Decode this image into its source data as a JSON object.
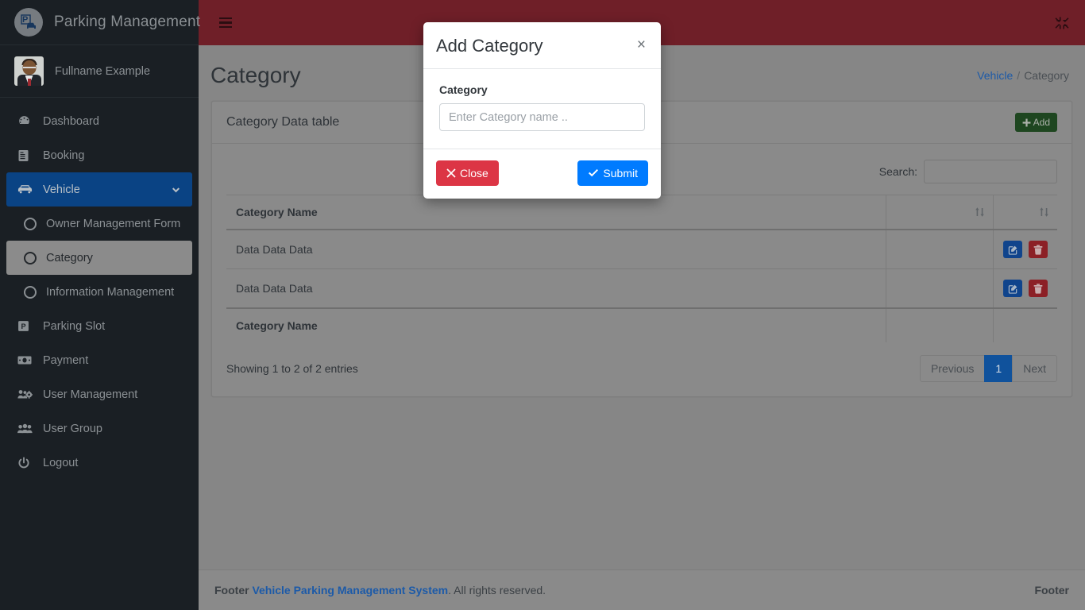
{
  "brand": {
    "title": "Parking Management",
    "logo_icon": "parking-car-logo-icon"
  },
  "user": {
    "name": "Fullname Example",
    "avatar_icon": "user-avatar"
  },
  "sidebar": {
    "items": [
      {
        "label": "Dashboard",
        "icon": "dashboard-icon",
        "type": "item"
      },
      {
        "label": "Booking",
        "icon": "book-icon",
        "type": "item"
      },
      {
        "label": "Vehicle",
        "icon": "car-icon",
        "type": "item",
        "active": true,
        "chevron": "chevron-down-icon"
      },
      {
        "label": "Owner Management Form",
        "icon": "circle-icon",
        "type": "sub"
      },
      {
        "label": "Category",
        "icon": "circle-icon",
        "type": "sub",
        "active": true
      },
      {
        "label": "Information Management",
        "icon": "circle-icon",
        "type": "sub"
      },
      {
        "label": "Parking Slot",
        "icon": "parking-square-icon",
        "type": "item"
      },
      {
        "label": "Payment",
        "icon": "money-bill-icon",
        "type": "item"
      },
      {
        "label": "User Management",
        "icon": "users-cog-icon",
        "type": "item"
      },
      {
        "label": "User Group",
        "icon": "users-icon",
        "type": "item"
      },
      {
        "label": "Logout",
        "icon": "power-off-icon",
        "type": "item"
      }
    ]
  },
  "navbar": {
    "menu_toggle_icon": "hamburger-icon",
    "fullscreen_icon": "compress-icon",
    "bg_color": "#6f1f28"
  },
  "page": {
    "title": "Category",
    "breadcrumb": {
      "parent": "Vehicle",
      "separator": "/",
      "current": "Category"
    }
  },
  "card": {
    "title": "Category Data table",
    "add_button": {
      "label": "Add",
      "icon": "plus-icon",
      "color": "#1e4620"
    }
  },
  "datatable": {
    "search_label": "Search:",
    "search_value": "",
    "search_placeholder": "",
    "columns": [
      "Category Name",
      "",
      ""
    ],
    "header": {
      "col1": "Category Name",
      "col2": "",
      "col3": ""
    },
    "footer_row": {
      "col1": "Category Name",
      "col2": "",
      "col3": ""
    },
    "sort_icon": "sort-arrows-icon",
    "rows": [
      {
        "name": "Data Data Data",
        "edit_icon": "edit-pencil-icon",
        "delete_icon": "trash-icon"
      },
      {
        "name": "Data Data Data",
        "edit_icon": "edit-pencil-icon",
        "delete_icon": "trash-icon"
      }
    ],
    "info": "Showing 1 to 2 of 2 entries",
    "pagination": {
      "previous": "Previous",
      "pages": [
        "1"
      ],
      "current_page": "1",
      "next": "Next",
      "active_color": "#10529c"
    }
  },
  "modal": {
    "title": "Add Category",
    "close_icon": "times-icon",
    "field_label": "Category",
    "field_value": "",
    "field_placeholder": "Enter Category name ..",
    "buttons": {
      "close": {
        "label": "Close",
        "icon": "times-icon",
        "color": "#dc3545"
      },
      "submit": {
        "label": "Submit",
        "icon": "check-icon",
        "color": "#007bff"
      }
    }
  },
  "footer": {
    "prefix": "Footer",
    "link": "Vehicle Parking Management System",
    "suffix": ". All rights reserved.",
    "right": "Footer"
  }
}
